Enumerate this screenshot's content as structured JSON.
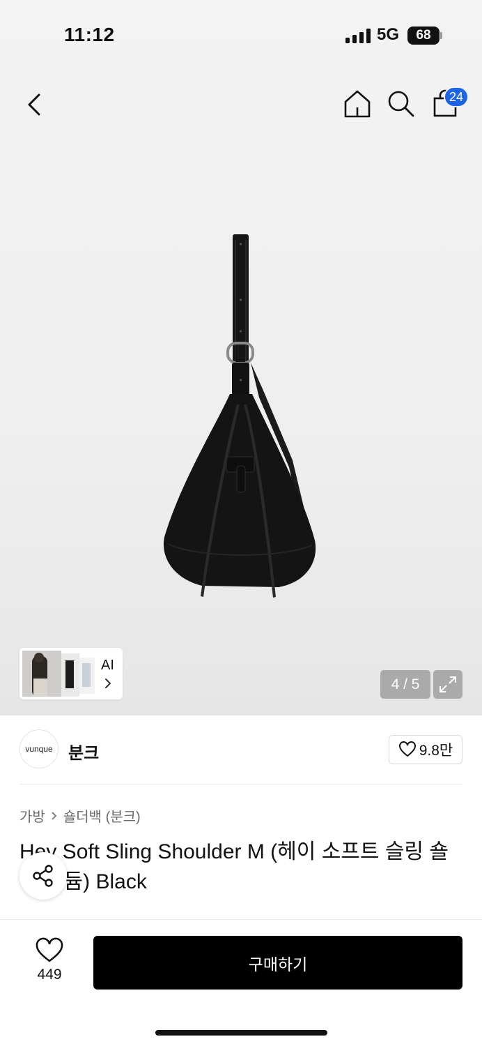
{
  "status_bar": {
    "time": "11:12",
    "network": "5G",
    "battery": "68"
  },
  "nav": {
    "cart_count": "24"
  },
  "gallery": {
    "counter": "4 / 5",
    "ai_label": "AI"
  },
  "brand": {
    "logo_text": "vunque",
    "name": "분크",
    "likes": "9.8만"
  },
  "breadcrumb": {
    "category": "가방",
    "subcategory": "숄더백 (분크)"
  },
  "product": {
    "title": "Hey Soft Sling Shoulder M (헤이 소프트 슬링 숄더 미듐) Black"
  },
  "bottom": {
    "wishlist_count": "449",
    "buy_label": "구매하기"
  },
  "colors": {
    "badge": "#1e64e6",
    "buy_button": "#000000"
  }
}
